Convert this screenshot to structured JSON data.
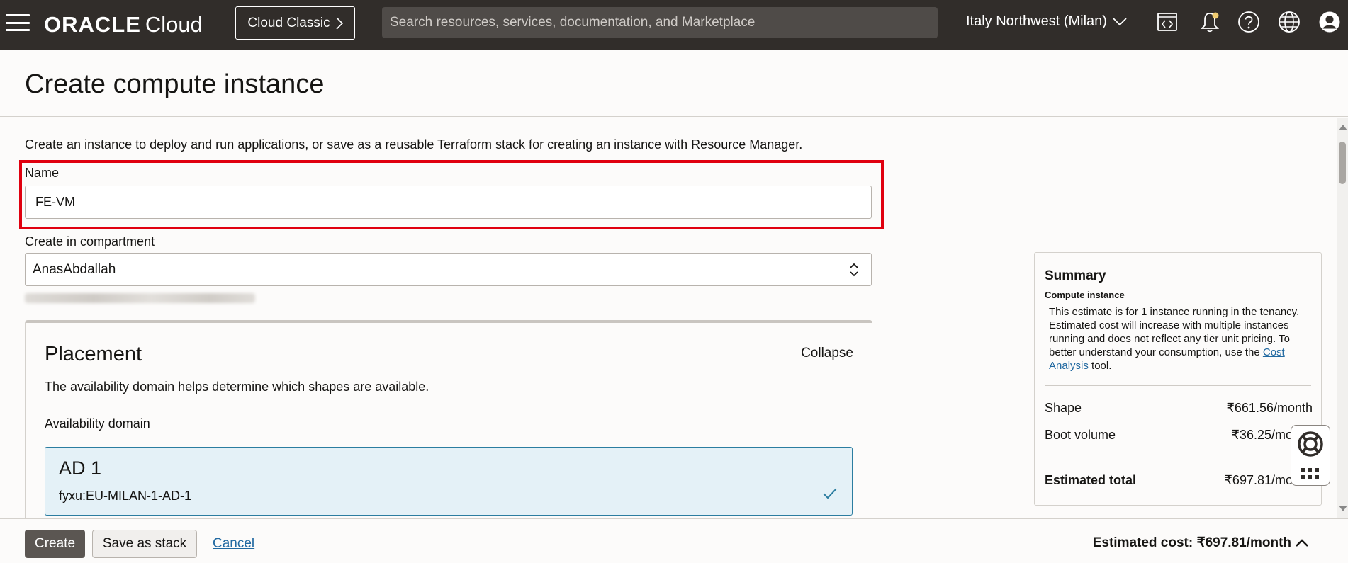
{
  "header": {
    "logo_oracle": "ORACLE",
    "logo_cloud": "Cloud",
    "cloud_classic_label": "Cloud Classic",
    "search_placeholder": "Search resources, services, documentation, and Marketplace",
    "region_label": "Italy Northwest (Milan)",
    "icons": [
      "code-editor-icon",
      "bell-icon",
      "help-icon",
      "globe-icon",
      "user-icon"
    ],
    "notification_dot_color": "#f0cc71"
  },
  "page": {
    "title": "Create compute instance",
    "intro": "Create an instance to deploy and run applications, or save as a reusable Terraform stack for creating an instance with Resource Manager."
  },
  "form": {
    "name_label": "Name",
    "name_value": "FE-VM",
    "compartment_label": "Create in compartment",
    "compartment_value": "AnasAbdallah"
  },
  "placement": {
    "title": "Placement",
    "collapse_label": "Collapse",
    "description": "The availability domain helps determine which shapes are available.",
    "ad_label": "Availability domain",
    "ad_selected_name": "AD 1",
    "ad_selected_id": "fyxu:EU-MILAN-1-AD-1"
  },
  "summary": {
    "title": "Summary",
    "subtitle": "Compute instance",
    "note_before_link": "This estimate is for 1 instance running in the tenancy. Estimated cost will increase with multiple instances running and does not reflect any tier unit pricing. To better understand your consumption, use the ",
    "note_link": "Cost Analysis",
    "note_after_link": " tool.",
    "shape_label": "Shape",
    "shape_value": "₹661.56/month",
    "boot_label": "Boot volume",
    "boot_value": "₹36.25/mo",
    "total_label": "Estimated total",
    "total_value": "₹697.81/mo"
  },
  "footer": {
    "create_label": "Create",
    "save_stack_label": "Save as stack",
    "cancel_label": "Cancel",
    "estimated_cost": "Estimated cost: ₹697.81/month"
  },
  "colors": {
    "topbar": "#312d2a",
    "highlight": "#e0000f",
    "selected_card": "#e4f1f7",
    "link": "#2169a1"
  }
}
